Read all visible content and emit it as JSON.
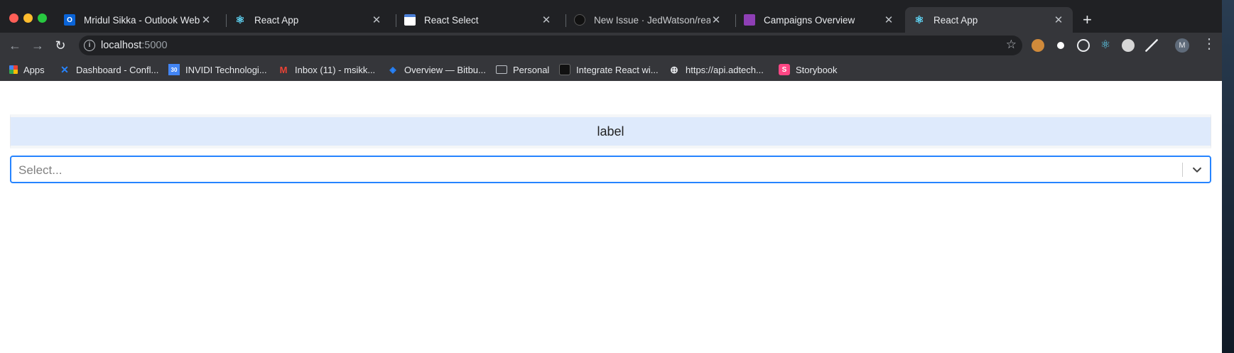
{
  "tabs": [
    {
      "title": "Mridul Sikka - Outlook Web App",
      "favicon": "outlook-icon",
      "color": "#0a64d8",
      "glyph": "O"
    },
    {
      "title": "React App",
      "favicon": "react-icon",
      "color": "#61dafb",
      "glyph": "⚛"
    },
    {
      "title": "React Select",
      "favicon": "window-icon",
      "color": "#4a7fd6",
      "glyph": "▤"
    },
    {
      "title": "New Issue · JedWatson/react-select",
      "favicon": "github-icon",
      "color": "#111111",
      "glyph": "●"
    },
    {
      "title": "Campaigns Overview",
      "favicon": "campaign-icon",
      "color": "#8e3fb5",
      "glyph": "▰"
    },
    {
      "title": "React App",
      "favicon": "react-icon",
      "color": "#61dafb",
      "glyph": "⚛",
      "active": true
    }
  ],
  "toolbar": {
    "url_host": "localhost",
    "url_port": ":5000",
    "avatar_initial": "M"
  },
  "bookmarks": [
    {
      "label": "Apps",
      "icon": "apps-grid-icon",
      "color": "#ea4335"
    },
    {
      "label": "Dashboard - Confl...",
      "icon": "confluence-icon",
      "color": "#2684ff"
    },
    {
      "label": "INVIDI Technologi...",
      "icon": "calendar-icon",
      "color": "#4285f4"
    },
    {
      "label": "Inbox (11) - msikk...",
      "icon": "gmail-icon",
      "color": "#ea4335"
    },
    {
      "label": "Overview — Bitbu...",
      "icon": "bitbucket-icon",
      "color": "#2684ff"
    },
    {
      "label": "Personal",
      "icon": "folder-icon",
      "color": "#bdc1c6"
    },
    {
      "label": "Integrate React wi...",
      "icon": "page-icon",
      "color": "#111111"
    },
    {
      "label": "https://api.adtech...",
      "icon": "globe-icon",
      "color": "#e8eaed"
    },
    {
      "label": "Storybook",
      "icon": "storybook-icon",
      "color": "#ff4785"
    }
  ],
  "page": {
    "label": "label",
    "select_placeholder": "Select..."
  }
}
